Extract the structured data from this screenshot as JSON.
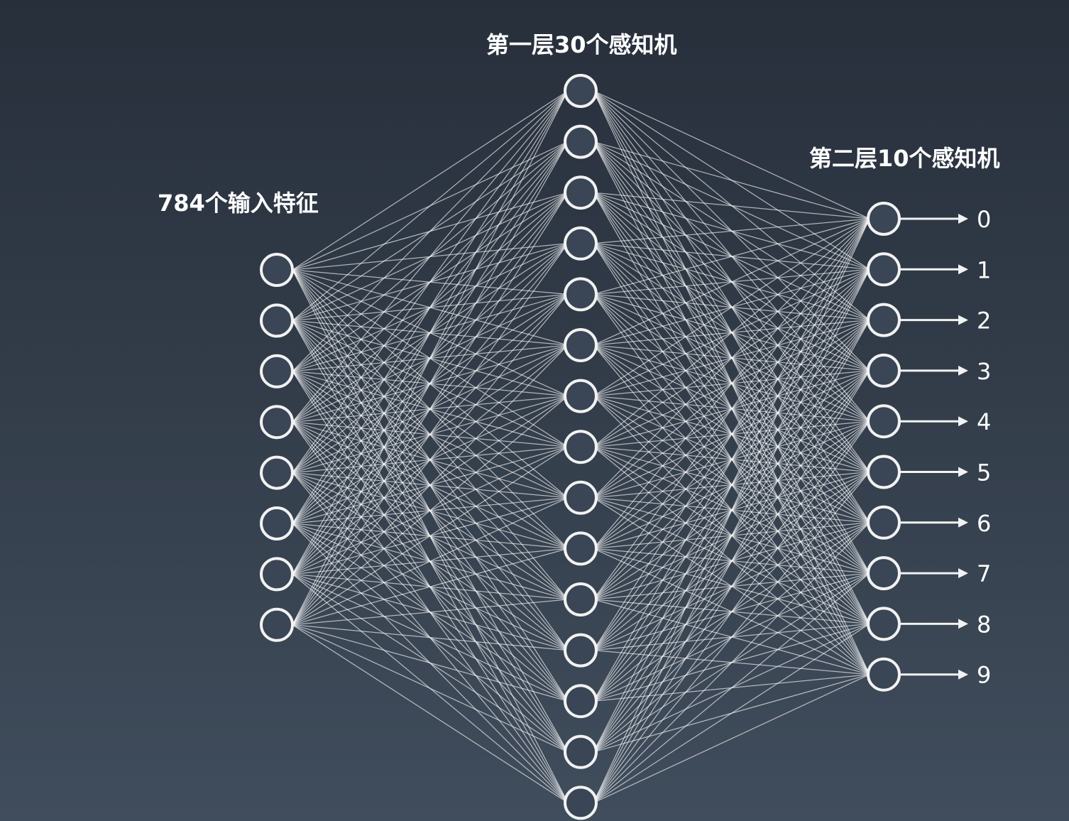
{
  "labels": {
    "input_layer": "784个输入特征",
    "hidden_layer": "第一层30个感知机",
    "output_layer": "第二层10个感知机"
  },
  "network": {
    "input_nodes_shown": 8,
    "hidden_nodes_shown": 15,
    "output_nodes_shown": 10
  },
  "outputs": [
    "0",
    "1",
    "2",
    "3",
    "4",
    "5",
    "6",
    "7",
    "8",
    "9"
  ],
  "colors": {
    "background_top": "#272f3b",
    "background_bottom": "#404d5c",
    "lines": "#ffffff",
    "text": "#ffffff"
  }
}
